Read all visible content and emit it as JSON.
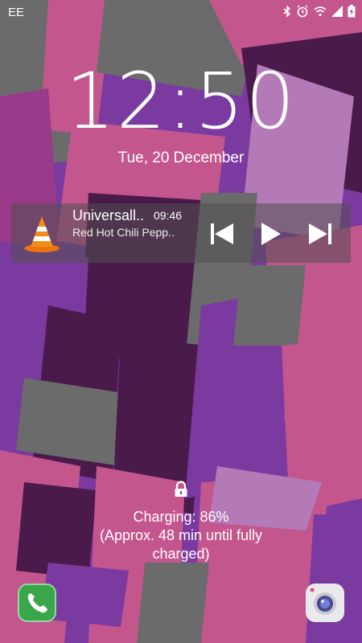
{
  "status_bar": {
    "carrier": "EE",
    "icons": [
      "bluetooth-icon",
      "alarm-icon",
      "wifi-icon",
      "signal-icon",
      "battery-charging-icon"
    ]
  },
  "lockscreen": {
    "time": "12:50",
    "date": "Tue, 20 December"
  },
  "media_notification": {
    "app_icon": "vlc-icon",
    "title": "Universall..",
    "time": "09:46",
    "artist": "Red Hot Chili Pepp..",
    "controls": [
      "previous-icon",
      "play-icon",
      "next-icon"
    ]
  },
  "charging": {
    "line1": "Charging: 86%",
    "line2": "(Approx. 48 min until fully",
    "line3": "charged)"
  },
  "shortcuts": {
    "left": "phone-icon",
    "right": "camera-icon"
  },
  "colors": {
    "wallpaper_purple": "#7a3aa0",
    "wallpaper_pink": "#c4568e",
    "wallpaper_grey": "#6b6b6b",
    "wallpaper_dark": "#4a1a4a",
    "wallpaper_lilac": "#b47ab8"
  }
}
